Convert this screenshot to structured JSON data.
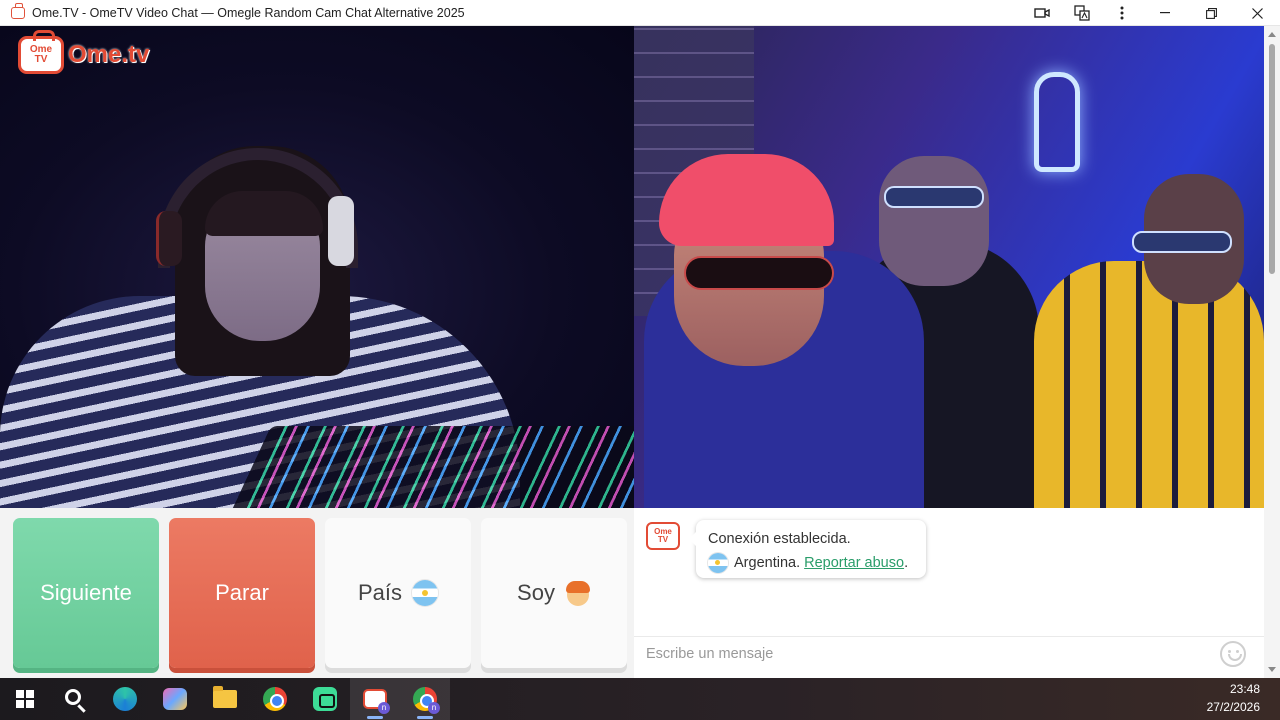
{
  "window": {
    "title": "Ome.TV - OmeTV Video Chat — Omegle Random Cam Chat Alternative 2025",
    "actions": [
      "camera-icon",
      "translate-icon",
      "more-icon",
      "minimize-icon",
      "maximize-icon",
      "close-icon"
    ]
  },
  "logo": {
    "tv_top": "Ome",
    "tv_bottom": "TV",
    "word": "Ome.tv"
  },
  "controls": {
    "next_label": "Siguiente",
    "stop_label": "Parar",
    "country_label": "País",
    "gender_label": "Soy"
  },
  "chat": {
    "logo_top": "Ome",
    "logo_bottom": "TV",
    "status": "Conexión establecida.",
    "country": "Argentina.",
    "report_link": "Reportar abuso",
    "report_suffix": ".",
    "input_placeholder": "Escribe un mensaje"
  },
  "taskbar": {
    "time": "23:48",
    "date": "27/2/2026",
    "badge": "n"
  },
  "colors": {
    "next": "#6fd09f",
    "stop": "#e66a52",
    "brand": "#e24b35",
    "link": "#2a9d6a"
  }
}
